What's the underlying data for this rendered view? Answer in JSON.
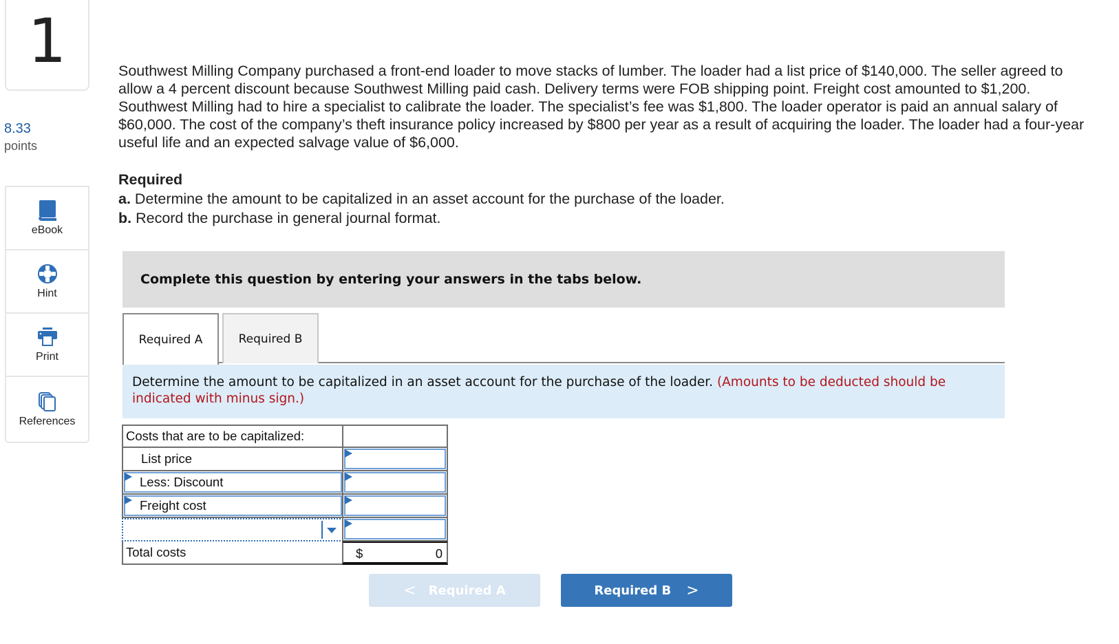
{
  "question": {
    "number": "1",
    "points_value": "8.33",
    "points_label": "points"
  },
  "sidebar": {
    "tools": [
      {
        "label": "eBook",
        "icon": "book-icon"
      },
      {
        "label": "Hint",
        "icon": "lifebuoy-icon"
      },
      {
        "label": "Print",
        "icon": "printer-icon"
      },
      {
        "label": "References",
        "icon": "copy-pages-icon"
      }
    ]
  },
  "problem": {
    "text": "Southwest Milling Company purchased a front-end loader to move stacks of lumber. The loader had a list price of $140,000. The seller agreed to allow a 4 percent discount because Southwest Milling paid cash. Delivery terms were FOB shipping point. Freight cost amounted to $1,200. Southwest Milling had to hire a specialist to calibrate the loader. The specialist’s fee was $1,800. The loader operator is paid an annual salary of $60,000. The cost of the company’s theft insurance policy increased by $800 per year as a result of acquiring the loader. The loader had a four-year useful life and an expected salvage value of $6,000.",
    "required_heading": "Required",
    "req_a_prefix": "a.",
    "req_a_text": " Determine the amount to be capitalized in an asset account for the purchase of the loader.",
    "req_b_prefix": "b.",
    "req_b_text": " Record the purchase in general journal format."
  },
  "instructions": "Complete this question by entering your answers in the tabs below.",
  "tabs": [
    {
      "label": "Required A",
      "active": true
    },
    {
      "label": "Required B",
      "active": false
    }
  ],
  "part_a": {
    "prompt": "Determine the amount to be capitalized in an asset account for the purchase of the loader. ",
    "note": "(Amounts to be deducted should be indicated with minus sign.)"
  },
  "table": {
    "header": "Costs that are to be capitalized:",
    "rows": [
      {
        "label": "List price",
        "amount": ""
      },
      {
        "label": "Less: Discount",
        "amount": ""
      },
      {
        "label": "Freight cost",
        "amount": ""
      },
      {
        "label": "",
        "amount": "",
        "type": "dropdown"
      }
    ],
    "total_label": "Total costs",
    "total_currency": "$",
    "total_value": "0"
  },
  "navigation": {
    "prev_label": "Required A",
    "next_label": "Required B",
    "prev_chevron": "<",
    "next_chevron": ">"
  },
  "colors": {
    "accent": "#3676b8",
    "note_red": "#b3151b",
    "banner_gray": "#dedede",
    "banner_blue": "#dcecf8"
  }
}
